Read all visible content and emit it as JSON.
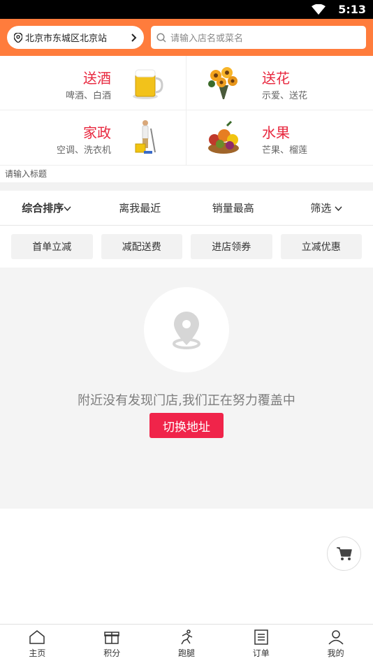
{
  "status": {
    "time": "5:13"
  },
  "header": {
    "location": "北京市东城区北京站",
    "search_placeholder": "请输入店名或菜名"
  },
  "categories": [
    {
      "title": "送酒",
      "subtitle": "啤酒、白酒",
      "icon": "beer-mug-icon"
    },
    {
      "title": "送花",
      "subtitle": "示爱、送花",
      "icon": "flower-bouquet-icon"
    },
    {
      "title": "家政",
      "subtitle": "空调、洗衣机",
      "icon": "cleaning-person-icon"
    },
    {
      "title": "水果",
      "subtitle": "芒果、榴莲",
      "icon": "fruit-basket-icon"
    }
  ],
  "hint": "请输入标题",
  "sort": {
    "items": [
      "综合排序",
      "离我最近",
      "销量最高",
      "筛选"
    ]
  },
  "chips": [
    "首单立减",
    "减配送费",
    "进店领券",
    "立减优惠"
  ],
  "empty": {
    "message": "附近没有发现门店,我们正在努力覆盖中",
    "button": "切换地址"
  },
  "tabs": [
    {
      "label": "主页",
      "icon": "home-icon"
    },
    {
      "label": "积分",
      "icon": "gift-icon"
    },
    {
      "label": "跑腿",
      "icon": "runner-icon"
    },
    {
      "label": "订单",
      "icon": "order-list-icon"
    },
    {
      "label": "我的",
      "icon": "user-icon"
    }
  ],
  "colors": {
    "accent": "#ff7c3c",
    "red": "#f0244a",
    "title_red": "#e8283f"
  }
}
